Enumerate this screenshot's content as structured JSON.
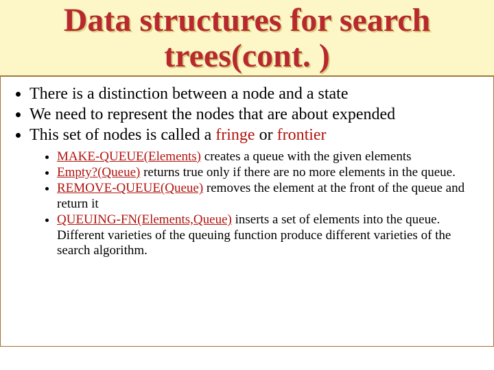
{
  "title": "Data structures for search trees(cont. )",
  "bullets": {
    "b1": "There is a distinction between a node and a state",
    "b2": "We need to represent the nodes that are about expended",
    "b3_part1": "This set of nodes is called a ",
    "b3_term1": "fringe",
    "b3_mid": " or ",
    "b3_term2": "frontier"
  },
  "subs": {
    "s1_fn": "MAKE-QUEUE(Elements)",
    "s1_rest": " creates a queue with the given elements",
    "s2_fn": "Empty?(Queue)",
    "s2_rest": " returns true only if there are no more elements in the queue.",
    "s3_fn": "REMOVE-QUEUE(Queue)",
    "s3_rest": " removes the element at the front of the queue and return it",
    "s4_fn": "QUEUING-FN(Elements,Queue)",
    "s4_rest": " inserts a set of elements into the queue. Different varieties of the queuing function produce different varieties of the search algorithm."
  }
}
